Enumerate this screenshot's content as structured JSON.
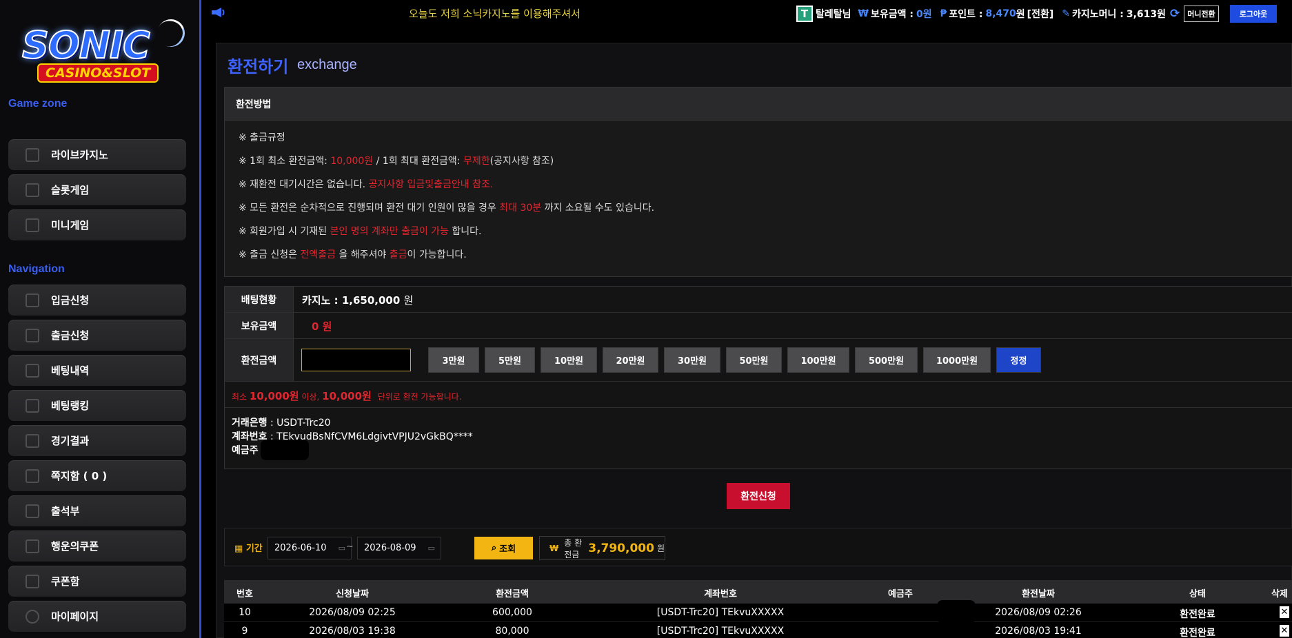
{
  "sidebar": {
    "game_zone_title": "Game zone",
    "navigation_title": "Navigation",
    "game_items": [
      {
        "label": "라이브카지노",
        "icon": "phone-card-icon"
      },
      {
        "label": "슬롯게임",
        "icon": "slot-lever-icon"
      },
      {
        "label": "미니게임",
        "icon": "mini-game-icon"
      }
    ],
    "nav_items": [
      {
        "label": "입금신청",
        "icon": "deposit-icon"
      },
      {
        "label": "출금신청",
        "icon": "wallet-icon"
      },
      {
        "label": "베팅내역",
        "icon": "history-icon"
      },
      {
        "label": "베팅랭킹",
        "icon": "ranking-icon"
      },
      {
        "label": "경기결과",
        "icon": "trophy-icon"
      },
      {
        "label": "쪽지함 ( 0 )",
        "icon": "mail-icon"
      },
      {
        "label": "출석부",
        "icon": "calendar-icon"
      },
      {
        "label": "행운의쿠폰",
        "icon": "coupon-icon"
      },
      {
        "label": "쿠폰함",
        "icon": "coupon-box-icon"
      },
      {
        "label": "마이페이지",
        "icon": "gear-icon"
      }
    ],
    "logo": {
      "main": "SONIC",
      "sub": "CASINO&SLOT"
    }
  },
  "topbar": {
    "marquee": "오늘도 저희 소닉카지노를 이용해주셔서",
    "user_name": "탈레탈님",
    "balance_label": "보유금액 :",
    "balance_value": "0원",
    "point_label": "포인트 :",
    "point_value": "8,470",
    "point_unit": "원",
    "point_convert": "[전환]",
    "casino_label": "카지노머니 :",
    "casino_value": "3,613원",
    "money_convert_btn": "머니전환",
    "logout_btn": "로그아웃",
    "won_symbol": "₩",
    "point_symbol": "₱"
  },
  "page": {
    "title": "환전하기",
    "subtitle": "exchange"
  },
  "method": {
    "heading": "환전방법",
    "rules": [
      {
        "parts": [
          {
            "t": "※ 출금규정",
            "red": false
          }
        ]
      },
      {
        "parts": [
          {
            "t": "※ 1회 최소 환전금액: ",
            "red": false
          },
          {
            "t": "10,000원",
            "red": true
          },
          {
            "t": " / 1회 최대 환전금액: ",
            "red": false
          },
          {
            "t": "무제한",
            "red": true
          },
          {
            "t": "(공지사항 참조)",
            "red": false
          }
        ]
      },
      {
        "parts": [
          {
            "t": "※ 재환전 대기시간은 없습니다. ",
            "red": false
          },
          {
            "t": "공지사항 입금및출금안내 참조.",
            "red": true
          }
        ]
      },
      {
        "parts": [
          {
            "t": "※ 모든 환전은 순차적으로 진행되며 환전 대기 인원이 많을 경우 ",
            "red": false
          },
          {
            "t": "최대 30분",
            "red": true
          },
          {
            "t": " 까지 소요될 수도 있습니다.",
            "red": false
          }
        ]
      },
      {
        "parts": [
          {
            "t": "※ 회원가입 시 기재된 ",
            "red": false
          },
          {
            "t": "본인 명의 계좌만 출금이 가능",
            "red": true
          },
          {
            "t": " 합니다.",
            "red": false
          }
        ]
      },
      {
        "parts": [
          {
            "t": "※ 출금 신청은 ",
            "red": false
          },
          {
            "t": "전액출금",
            "red": true
          },
          {
            "t": " 을 해주셔야 ",
            "red": false
          },
          {
            "t": "출금",
            "red": true
          },
          {
            "t": "이 가능합니다.",
            "red": false
          }
        ]
      }
    ]
  },
  "form": {
    "betting_label": "배팅현황",
    "betting_value": "카지노 : 1,650,000",
    "betting_unit": "원",
    "holding_label": "보유금액",
    "holding_value": "0 원",
    "amount_label": "환전금액",
    "amount_value": "",
    "amount_buttons": [
      "3만원",
      "5만원",
      "10만원",
      "20만원",
      "30만원",
      "50만원",
      "100만원",
      "500만원",
      "1000만원"
    ],
    "reset_button": "정정",
    "notice_prefix": "최소",
    "notice_min": "10,000원",
    "notice_mid": "이상,",
    "notice_unit": "10,000원",
    "notice_suffix": "단위로 환전 가능합니다.",
    "bank_label": "거래은행",
    "bank_value": ": USDT-Trc20",
    "account_label": "계좌번호",
    "account_value": ": TEkvudBsNfCVM6LdgivtVPJU2vGkBQ****",
    "holder_label": "예금주"
  },
  "submit_button": "환전신청",
  "filter": {
    "period_label": "기간",
    "date_from": "2026-06-10",
    "date_to": "2026-08-09",
    "tilde": "~",
    "search_button": "조회",
    "total_label": "총 환전금",
    "total_value": "3,790,000",
    "total_unit": "원"
  },
  "table": {
    "headers": [
      "번호",
      "신청날짜",
      "환전금액",
      "계좌번호",
      "예금주",
      "환전날짜",
      "상태",
      "삭제"
    ],
    "rows": [
      {
        "no": "10",
        "req_date": "2026/08/09 02:25",
        "amount": "600,000",
        "account": "[USDT-Trc20] TEkvuXXXXX",
        "holder": "",
        "ex_date": "2026/08/09 02:26",
        "status": "환전완료",
        "del": "✕"
      },
      {
        "no": "9",
        "req_date": "2026/08/03 19:38",
        "amount": "80,000",
        "account": "[USDT-Trc20] TEkvuXXXXX",
        "holder": "",
        "ex_date": "2026/08/03 19:41",
        "status": "환전완료",
        "del": "✕"
      }
    ]
  },
  "colors": {
    "accent_blue": "#3e63ff",
    "alert_red": "#e0262f",
    "submit_red": "#c8102e",
    "gold": "#f2b511"
  }
}
